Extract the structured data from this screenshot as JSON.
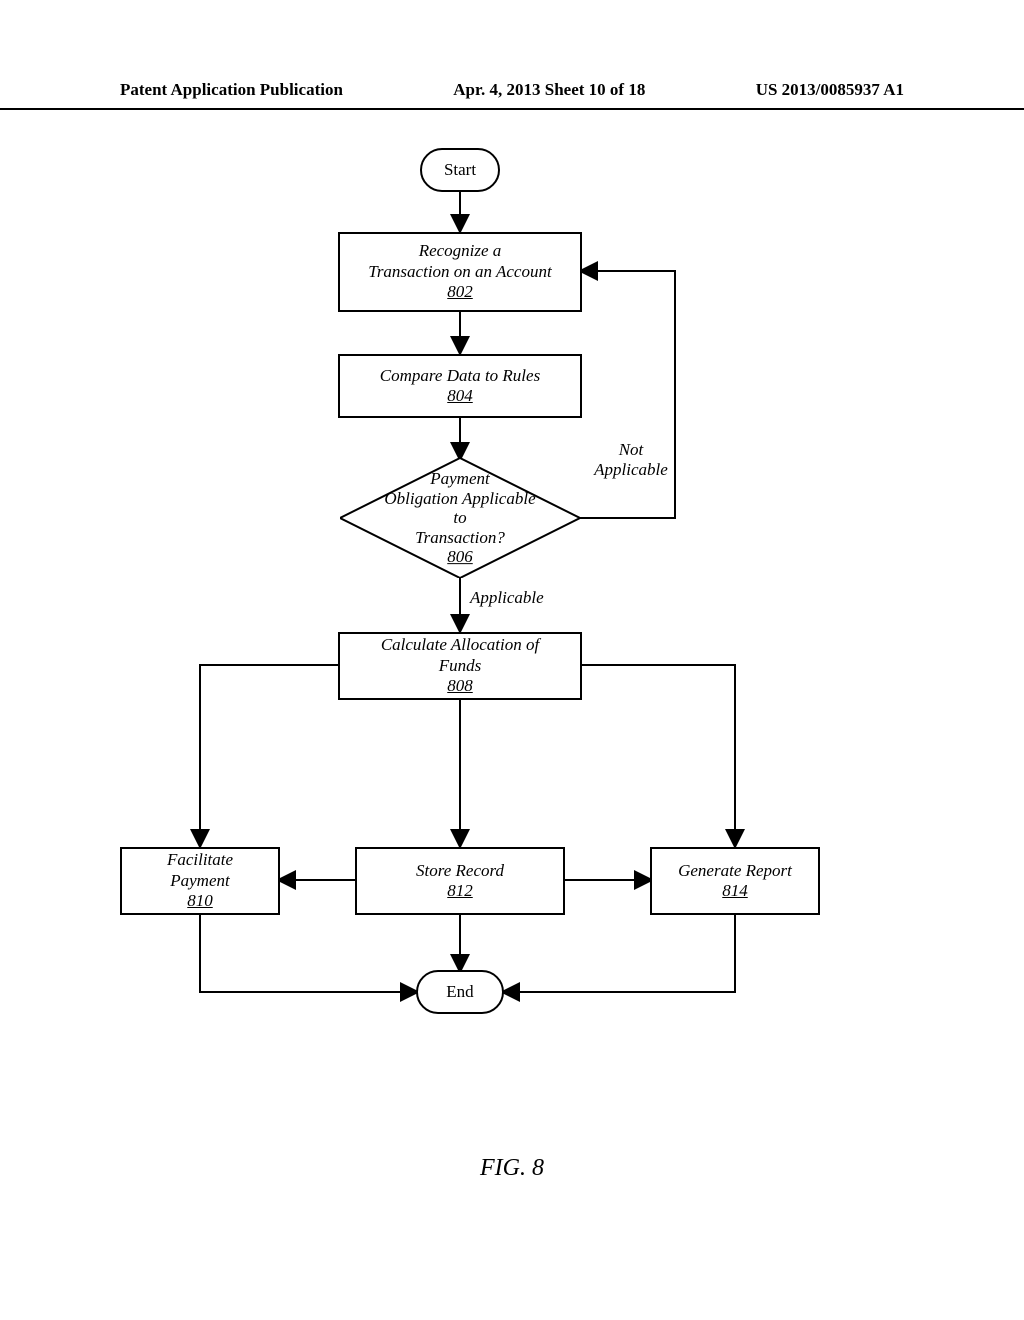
{
  "header": {
    "left": "Patent Application Publication",
    "mid": "Apr. 4, 2013  Sheet 10 of 18",
    "right": "US 2013/0085937 A1"
  },
  "nodes": {
    "start": "Start",
    "n802_t": "Recognize a\nTransaction on an Account",
    "n802_r": "802",
    "n804_t": "Compare Data to Rules",
    "n804_r": "804",
    "n806_t": "Payment\nObligation Applicable to\nTransaction?",
    "n806_r": "806",
    "n808_t": "Calculate Allocation of\nFunds",
    "n808_r": "808",
    "n810_t": "Facilitate\nPayment",
    "n810_r": "810",
    "n812_t": "Store Record",
    "n812_r": "812",
    "n814_t": "Generate Report",
    "n814_r": "814",
    "end": "End"
  },
  "branches": {
    "not_applicable": "Not\nApplicable",
    "applicable": "Applicable"
  },
  "figure": "FIG. 8"
}
